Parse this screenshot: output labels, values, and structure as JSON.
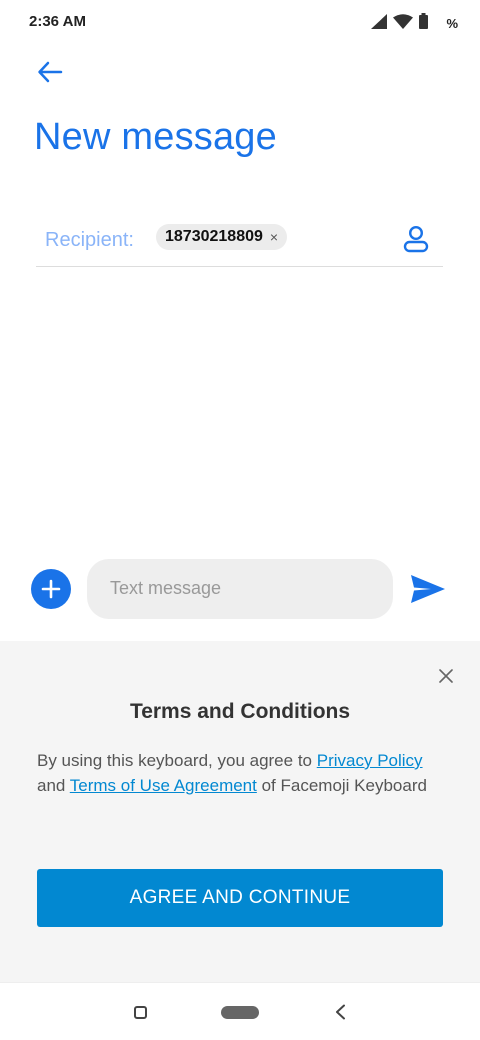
{
  "status_bar": {
    "time": "2:36 AM",
    "battery_text": "%",
    "icons": [
      "signal-icon",
      "wifi-icon",
      "battery-icon"
    ]
  },
  "header": {
    "title": "New message",
    "back_icon": "arrow-left-icon"
  },
  "recipient": {
    "label": "Recipient:",
    "chips": [
      {
        "value": "18730218809",
        "remove_symbol": "×"
      }
    ],
    "contact_icon": "person-icon"
  },
  "compose": {
    "placeholder": "Text message",
    "value": "",
    "add_icon": "plus-icon",
    "send_icon": "send-icon"
  },
  "terms": {
    "title": "Terms and Conditions",
    "body_prefix": "By using this keyboard, you agree to ",
    "link_privacy": "Privacy Policy",
    "body_middle": " and ",
    "link_terms": "Terms of Use Agreement",
    "body_suffix": " of Facemoji Keyboard",
    "agree_label": "AGREE AND CONTINUE",
    "close_icon": "close-icon"
  },
  "nav_bar": {
    "icons": [
      "recent-apps-icon",
      "home-icon",
      "back-icon"
    ]
  },
  "colors": {
    "accent": "#1a73e8",
    "accent_light": "#8ab4f8",
    "button": "#0288d1",
    "panel_bg": "#f5f5f5",
    "input_bg": "#eeeeee"
  }
}
